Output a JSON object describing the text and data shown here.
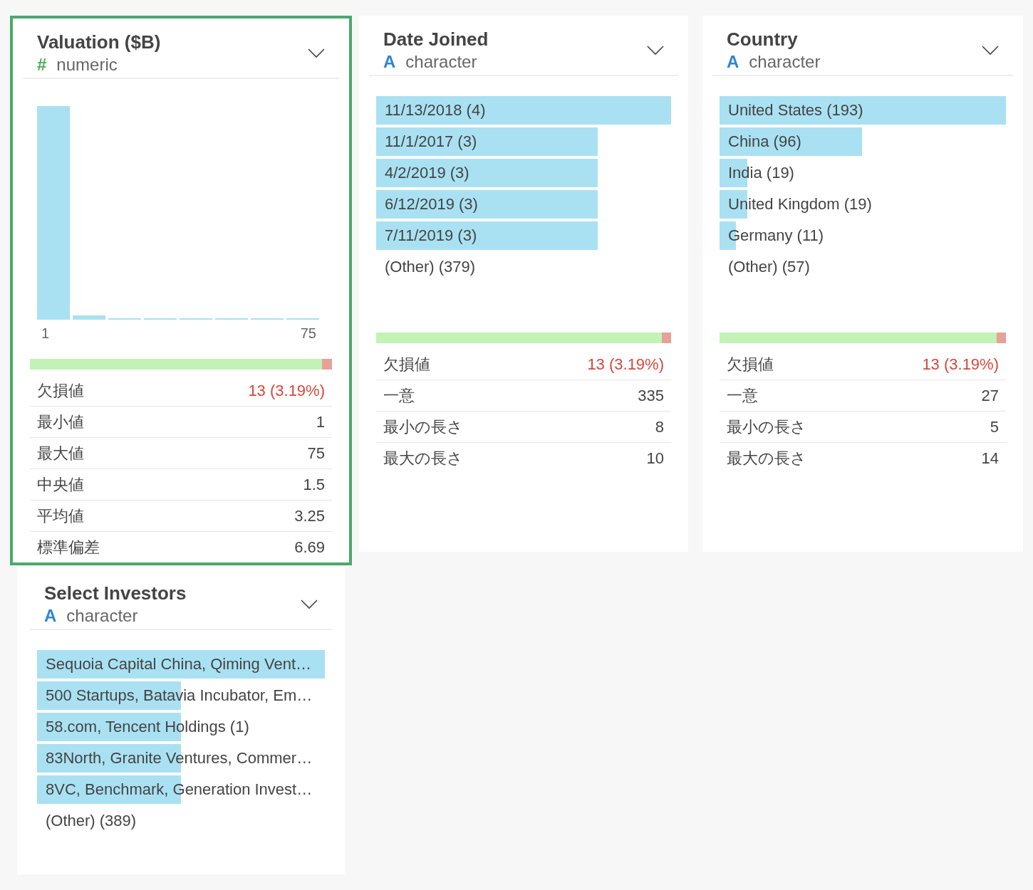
{
  "cards": [
    {
      "title": "Valuation ($B)",
      "selected": true,
      "type": {
        "kind": "numeric",
        "icon": "#",
        "label": "numeric"
      },
      "kind": "histogram",
      "axis_labels": [
        "1",
        "75"
      ],
      "missing_bar": {
        "level": 0.968
      },
      "stats": [
        {
          "label": "欠損値",
          "value": "13 (3.19%)",
          "kind": "missing"
        },
        {
          "label": "最小値",
          "value": "1",
          "kind": "plain"
        },
        {
          "label": "最大値",
          "value": "75",
          "kind": "plain"
        },
        {
          "label": "中央値",
          "value": "1.5",
          "kind": "plain"
        },
        {
          "label": "平均値",
          "value": "3.25",
          "kind": "plain"
        },
        {
          "label": "標準偏差",
          "value": "6.69",
          "kind": "plain"
        }
      ]
    },
    {
      "title": "Date Joined",
      "selected": false,
      "type": {
        "kind": "character",
        "icon": "A",
        "label": "character"
      },
      "kind": "categories",
      "missing_bar": {
        "level": 0.968
      },
      "values": [
        {
          "label": "11/13/2018 (4)",
          "kind": "bar",
          "level": 1
        },
        {
          "label": "11/1/2017 (3)",
          "kind": "bar",
          "level": 0.75
        },
        {
          "label": "4/2/2019 (3)",
          "kind": "bar",
          "level": 0.75
        },
        {
          "label": "6/12/2019 (3)",
          "kind": "bar",
          "level": 0.75
        },
        {
          "label": "7/11/2019 (3)",
          "kind": "bar",
          "level": 0.75
        },
        {
          "label": "(Other) (379)",
          "kind": "other"
        }
      ],
      "stats": [
        {
          "label": "欠損値",
          "value": "13 (3.19%)",
          "kind": "missing"
        },
        {
          "label": "一意",
          "value": "335",
          "kind": "plain"
        },
        {
          "label": "最小の長さ",
          "value": "8",
          "kind": "plain"
        },
        {
          "label": "最大の長さ",
          "value": "10",
          "kind": "plain"
        }
      ]
    },
    {
      "title": "Country",
      "selected": false,
      "type": {
        "kind": "character",
        "icon": "A",
        "label": "character"
      },
      "kind": "categories",
      "missing_bar": {
        "level": 0.968
      },
      "values": [
        {
          "label": "United States (193)",
          "kind": "bar",
          "level": 1
        },
        {
          "label": "China (96)",
          "kind": "bar",
          "level": 0.497
        },
        {
          "label": "India (19)",
          "kind": "bar",
          "level": 0.096
        },
        {
          "label": "United Kingdom (19)",
          "kind": "bar",
          "level": 0.096
        },
        {
          "label": "Germany (11)",
          "kind": "bar",
          "level": 0.057
        },
        {
          "label": "(Other) (57)",
          "kind": "other"
        }
      ],
      "stats": [
        {
          "label": "欠損値",
          "value": "13 (3.19%)",
          "kind": "missing"
        },
        {
          "label": "一意",
          "value": "27",
          "kind": "plain"
        },
        {
          "label": "最小の長さ",
          "value": "5",
          "kind": "plain"
        },
        {
          "label": "最大の長さ",
          "value": "14",
          "kind": "plain"
        }
      ]
    },
    {
      "title": "Select Investors",
      "selected": false,
      "type": {
        "kind": "character",
        "icon": "A",
        "label": "character"
      },
      "kind": "categories",
      "values": [
        {
          "label": "Sequoia Capital China, Qiming Vent…",
          "kind": "bar",
          "level": 1
        },
        {
          "label": "500 Startups, Batavia Incubator, Em…",
          "kind": "bar",
          "level": 0.5
        },
        {
          "label": "58.com, Tencent Holdings (1)",
          "kind": "bar",
          "level": 0.5
        },
        {
          "label": "83North, Granite Ventures, Commer…",
          "kind": "bar",
          "level": 0.5
        },
        {
          "label": "8VC, Benchmark, Generation Invest…",
          "kind": "bar",
          "level": 0.5
        },
        {
          "label": "(Other) (389)",
          "kind": "other"
        }
      ]
    }
  ]
}
